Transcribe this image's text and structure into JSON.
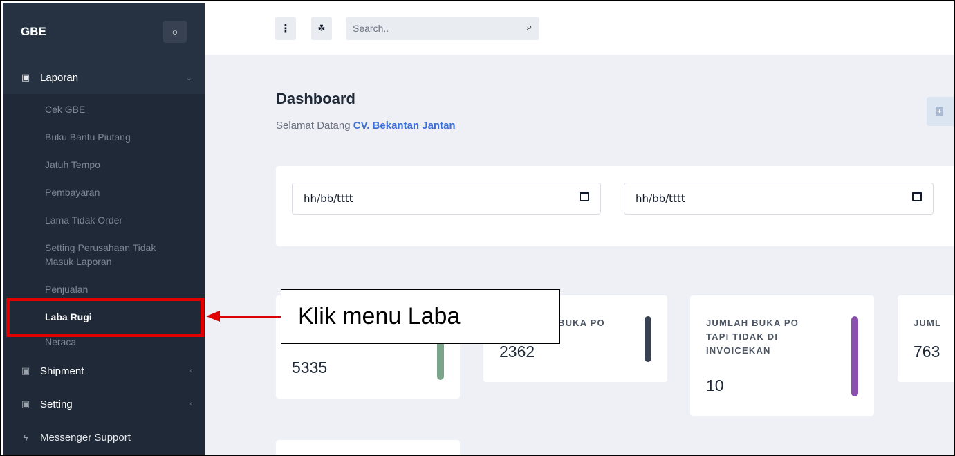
{
  "sidebar": {
    "brand": "GBE",
    "theme_icon": "drop-icon",
    "groups": [
      {
        "label": "Laporan",
        "icon": "boxes-icon",
        "chevron": "chevron-down-icon"
      },
      {
        "label": "Shipment",
        "icon": "boxes-icon",
        "chevron": "chevron-left-icon"
      },
      {
        "label": "Setting",
        "icon": "boxes-icon",
        "chevron": "chevron-left-icon"
      }
    ],
    "laporan_items": [
      "Cek GBE",
      "Buku Bantu Piutang",
      "Jatuh Tempo",
      "Pembayaran",
      "Lama Tidak Order",
      "Setting Perusahaan Tidak Masuk Laporan",
      "Penjualan",
      "Laba Rugi",
      "Neraca"
    ],
    "messenger": {
      "label": "Messenger Support",
      "icon": "bolt-icon"
    }
  },
  "topbar": {
    "menu_icon": "vertical-dots-icon",
    "link_icon": "sitemap-icon",
    "search_placeholder": "Search..",
    "search_icon": "search-icon"
  },
  "header": {
    "title": "Dashboard",
    "welcome_prefix": "Selamat Datang",
    "company": "CV. Bekantan Jantan"
  },
  "filters": {
    "date_start": "hh/bb/tttt",
    "date_end": "hh/bb/tttt"
  },
  "stats": [
    {
      "label_partial": "",
      "value": "5335",
      "bar_color": "#7aa58a"
    },
    {
      "label_partial": "BUKA PO",
      "value": "2362",
      "bar_color": "#374151"
    },
    {
      "label_lines": [
        "JUMLAH BUKA PO",
        "TAPI TIDAK DI",
        "INVOICEKAN"
      ],
      "value": "10",
      "bar_color": "#8b4fae"
    },
    {
      "label_partial": "JUML",
      "value": "763"
    }
  ],
  "annotation": {
    "text": "Klik menu Laba",
    "highlight_color": "#e00000"
  }
}
